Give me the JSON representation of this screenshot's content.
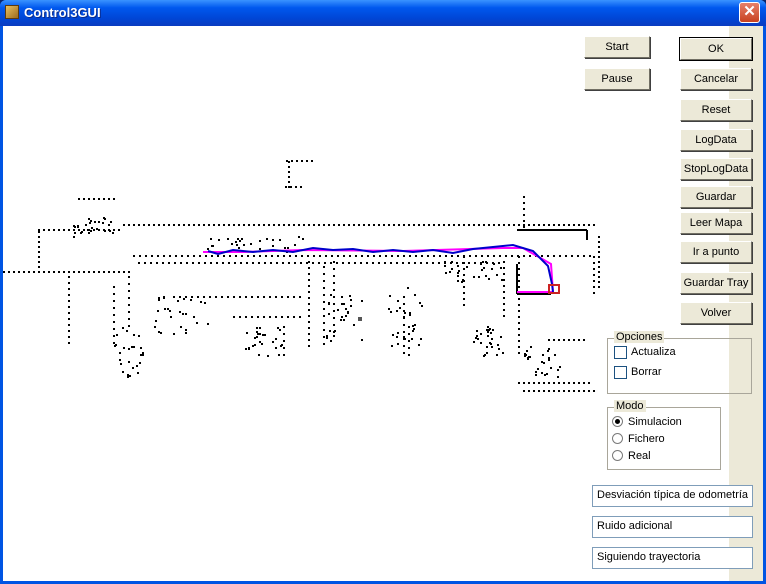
{
  "window": {
    "title": "Control3GUI",
    "close_label": "✕"
  },
  "buttons": {
    "start": "Start",
    "pause": "Pause",
    "ok": "OK",
    "cancelar": "Cancelar",
    "reset": "Reset",
    "logdata": "LogData",
    "stoplogdata": "StopLogData",
    "guardar_mapa": "Guardar Mapa",
    "leer_mapa": "Leer Mapa",
    "ir_a_punto": "Ir a punto",
    "guardar_tray": "Guardar Tray",
    "volver": "Volver"
  },
  "opciones": {
    "title": "Opciones",
    "actualiza": "Actualiza",
    "actualiza_checked": false,
    "borrar": "Borrar",
    "borrar_checked": false
  },
  "modo": {
    "title": "Modo",
    "options": [
      "Simulacion",
      "Fichero",
      "Real"
    ],
    "selected": "Simulacion"
  },
  "status": {
    "field1": "Desviación típica de odometría",
    "field2": "Ruido adicional",
    "field3": "Siguiendo trayectoria"
  },
  "colors": {
    "planned_path": "#ff00ff",
    "robot_path": "#0000cc",
    "map_points": "#000000",
    "robot": "#cc2222"
  }
}
